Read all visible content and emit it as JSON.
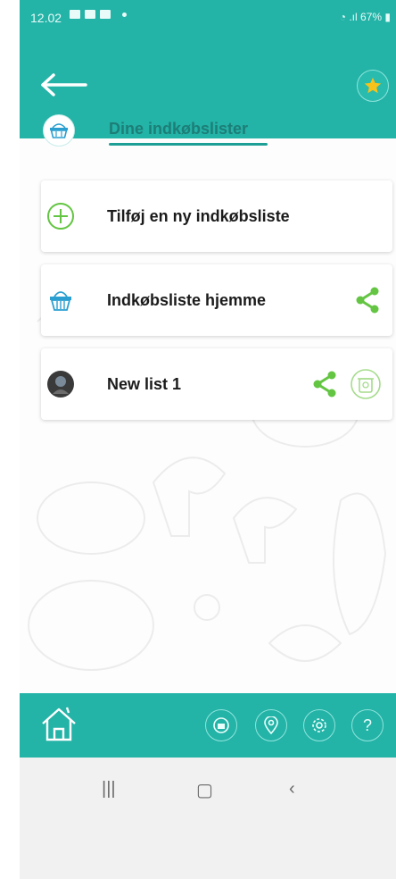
{
  "status_bar": {
    "time": "12.02",
    "battery": "67%"
  },
  "header": {
    "title": "Dine indkøbslister",
    "back_icon": "arrow-left-icon",
    "favorite_icon": "star-icon"
  },
  "lists": [
    {
      "label": "Tilføj en ny indkøbsliste",
      "icon": "plus-circle-icon",
      "share": false,
      "delete": false
    },
    {
      "label": "Indkøbsliste hjemme",
      "icon": "basket-icon",
      "share": true,
      "delete": false
    },
    {
      "label": "New list 1",
      "icon": "profile-photo",
      "share": true,
      "delete": true
    }
  ],
  "bottom_nav": {
    "home_icon": "home-icon",
    "items": [
      "shopping-list-icon",
      "location-pin-icon",
      "settings-icon",
      "help-icon"
    ],
    "help_label": "?"
  },
  "system_nav": [
    "recent-apps",
    "home",
    "back"
  ],
  "colors": {
    "teal": "#24b3a7",
    "green": "#63c542",
    "dark_teal": "#1d7e77"
  }
}
